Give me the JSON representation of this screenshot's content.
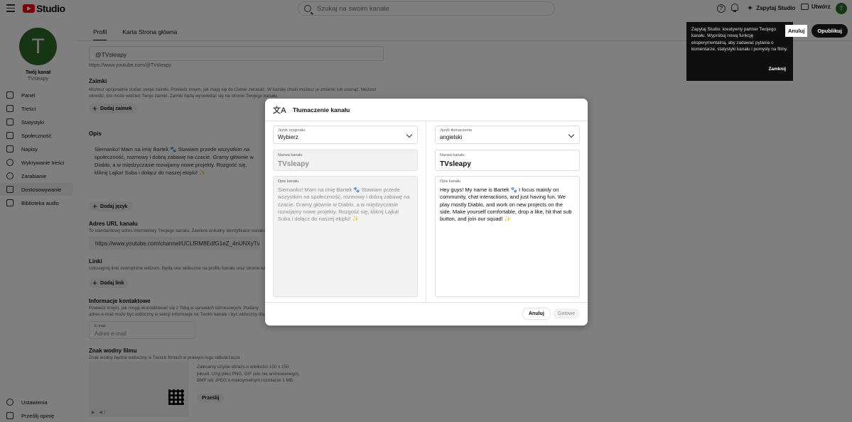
{
  "app": {
    "logo_text": "Studio"
  },
  "topbar": {
    "search_placeholder": "Szukaj na swoim kanale",
    "ask_studio": "Zapytaj Studio",
    "create": "Utwórz",
    "avatar_letter": "T"
  },
  "sidebar": {
    "avatar_letter": "T",
    "channel_label": "Twój kanał",
    "channel_name": "TVsleapy",
    "items": [
      {
        "label": "Panel"
      },
      {
        "label": "Treści"
      },
      {
        "label": "Statystyki"
      },
      {
        "label": "Społeczność"
      },
      {
        "label": "Napisy"
      },
      {
        "label": "Wykrywanie treści"
      },
      {
        "label": "Zarabianie"
      },
      {
        "label": "Dostosowywanie"
      },
      {
        "label": "Biblioteka audio"
      }
    ],
    "bottom": [
      {
        "label": "Ustawienia"
      },
      {
        "label": "Prześlij opinię"
      }
    ]
  },
  "tabs": [
    {
      "label": "Profil"
    },
    {
      "label": "Karta Strona główna"
    }
  ],
  "actions": {
    "cancel": "Anuluj",
    "publish": "Opublikuj"
  },
  "tooltip": {
    "text": "Zapytaj Studio: kreatywny partner Twojego kanału. Wypróbuj nową funkcję eksperymentalną, aby zadawać pytania o komentarze, statystyki kanału i pomysły na filmy.",
    "close": "Zamknij"
  },
  "profile": {
    "handle": "@TVsleapy",
    "handle_url": "https://www.youtube.com/@TVsleapy",
    "pronouns_title": "Zaimki",
    "pronouns_desc": "Możesz opcjonalnie dodać swoje zaimki. Powiedz innym, jak mają się do Ciebie zwracać. W każdej chwili możesz je zmienić lub usunąć. Możesz określić, kto może widzieć Twoje zaimki. Zaimki będą wyświetlać się na stronie Twojego kanału.",
    "pronouns_add": "Dodaj zaimek",
    "desc_title": "Opis",
    "desc_text": "Siemanko! Mam na imię Bartek 🐾 Stawiam przede wszystkim na społeczność, rozmowy i dobrą zabawę na czacie. Gramy głównie w Diablo, a w międzyczasie rozwijamy nowe projekty. Rozgość się, kliknij Lajka! Suba i dołącz do naszej ekipki! ✨",
    "add_language": "Dodaj język",
    "url_title": "Adres URL kanału",
    "url_desc": "To standardowy adres internetowy Twojego kanału. Zawiera unikalny identyfikator kanału.",
    "url_value": "https://www.youtube.com/channel/UCLfRM8EdfG1eZ_4nUNXyTvg",
    "links_title": "Linki",
    "links_desc": "Udostępnij linki zewnętrzne widzom. Będą one widoczne na profilu kanału oraz stronie kanału.",
    "links_add": "Dodaj link",
    "contact_title": "Informacje kontaktowe",
    "contact_desc": "Powiedz innym, jak mogą skontaktować się z Tobą w sprawach biznesowych. Podany adres e-mail może być widoczny w sekcji Informacje na Twoim kanale i być widoczny dla widzów.",
    "email_label": "E-mail",
    "email_placeholder": "Adres e-mail",
    "watermark_title": "Znak wodny filmu",
    "watermark_desc": "Znak wodny będzie widoczny w Twoich filmach w prawym rogu odtwarzacza",
    "watermark_hint": "Zalecamy użycie obrazu o wielkości 150 x 150 pikseli. Użyj pliku PNG, GIF (ale nie animowanego), BMP lub JPEG o maksymalnym rozmiarze 1 MB.",
    "upload": "Prześlij"
  },
  "modal": {
    "title": "Tłumaczenie kanału",
    "left": {
      "lang_label": "Język oryginału",
      "lang_value": "Wybierz",
      "name_label": "Nazwa kanału",
      "name_value": "TVsleapy",
      "desc_label": "Opis kanału",
      "desc_value": "Siemanko! Mam na imię Bartek 🐾 Stawiam przede wszystkim na społeczność, rozmowy i dobrą zabawę na czacie. Gramy głównie w Diablo, a w międzyczasie rozwijamy nowe projekty. Rozgość się, kliknij Lajka! Suba i dołącz do naszej ekipki! ✨"
    },
    "right": {
      "lang_label": "Język tłumaczenia",
      "lang_value": "angielski",
      "name_label": "Nazwa kanału",
      "name_value": "TVsleapy",
      "desc_label": "Opis kanału",
      "desc_value": "Hey guys! My name is Bartek 🐾 I focus mainly on community, chat interactions, and just having fun. We play mostly Diablo, and work on new projects on the side. Make yourself comfortable, drop a like, hit that sub button, and join our squad! ✨"
    },
    "cancel": "Anuluj",
    "done": "Gotowe"
  }
}
